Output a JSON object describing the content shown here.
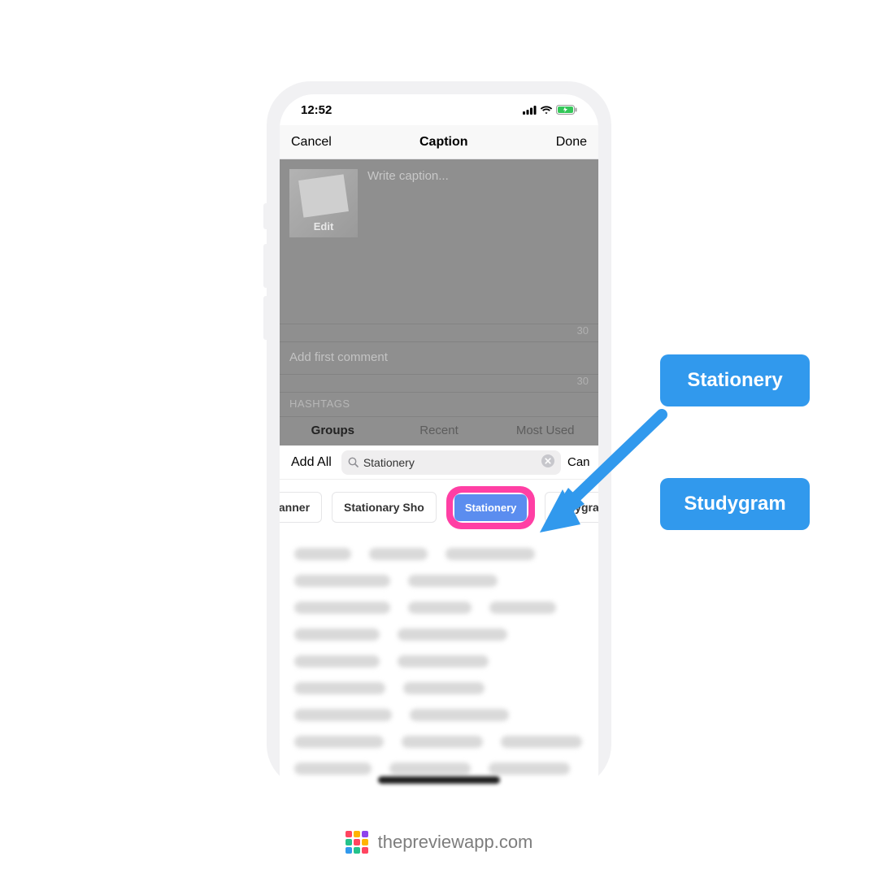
{
  "status": {
    "time": "12:52"
  },
  "nav": {
    "cancel": "Cancel",
    "title": "Caption",
    "done": "Done"
  },
  "caption": {
    "thumb_label": "Edit",
    "placeholder": "Write caption...",
    "count1": "30",
    "first_comment": "Add first comment",
    "count2": "30",
    "hashtags_label": "HASHTAGS"
  },
  "tabs": {
    "groups": "Groups",
    "recent": "Recent",
    "most_used": "Most Used"
  },
  "search": {
    "add_all": "Add All",
    "value": "Stationery",
    "cancel": "Cancel"
  },
  "chips": {
    "c1": "lanner",
    "c2": "Stationary Sho",
    "c3": "Stationery",
    "c4": "tudygram"
  },
  "callouts": {
    "c1": "Stationery",
    "c2": "Studygram"
  },
  "footer": {
    "url": "thepreviewapp.com"
  }
}
